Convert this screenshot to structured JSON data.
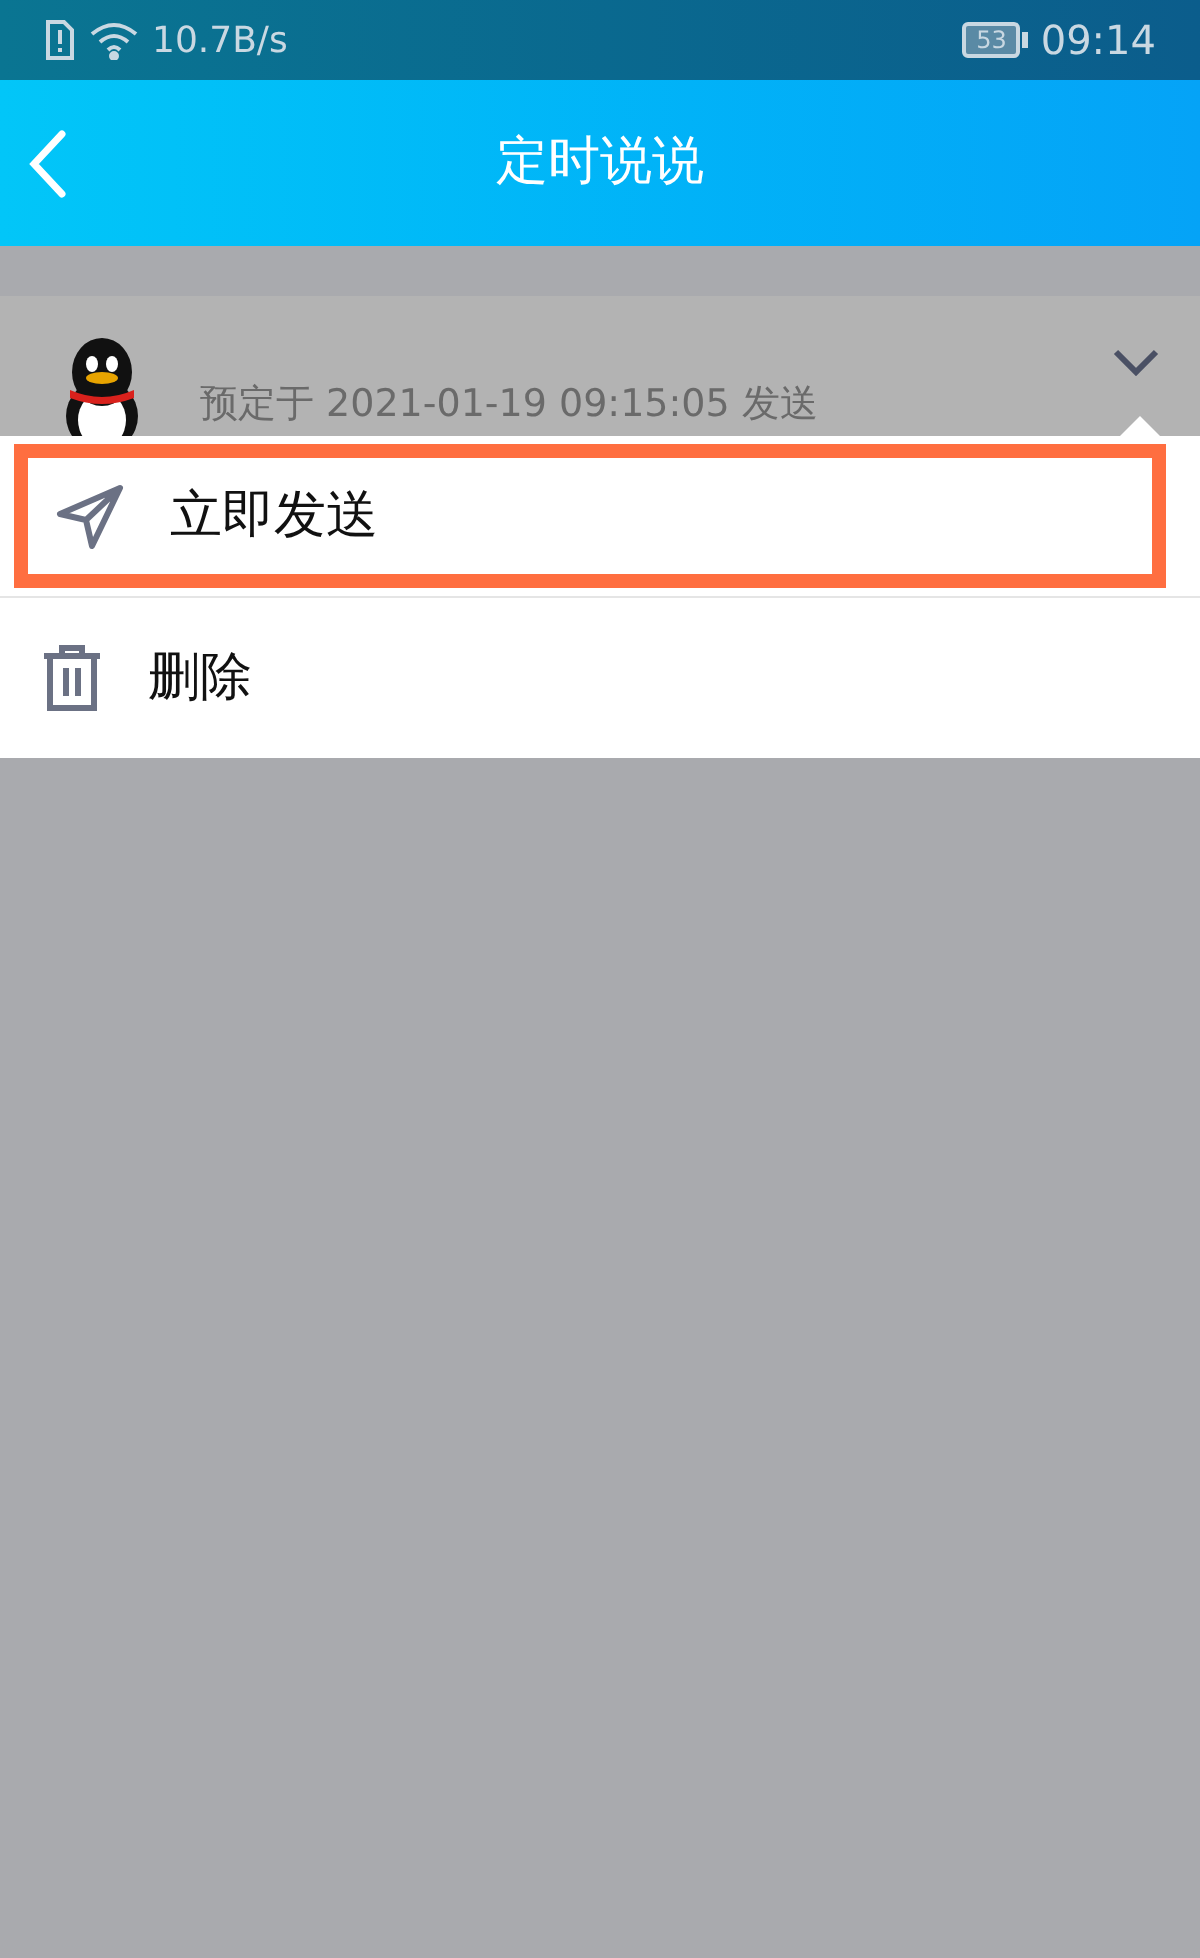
{
  "status_bar": {
    "speed": "10.7B/s",
    "battery": "53",
    "time": "09:14"
  },
  "header": {
    "title": "定时说说"
  },
  "post": {
    "schedule": "预定于 2021-01-19 09:15:05 发送"
  },
  "menu": [
    {
      "kind": "send",
      "label": "立即发送",
      "highlighted": true
    },
    {
      "kind": "delete",
      "label": "删除",
      "highlighted": false
    }
  ]
}
